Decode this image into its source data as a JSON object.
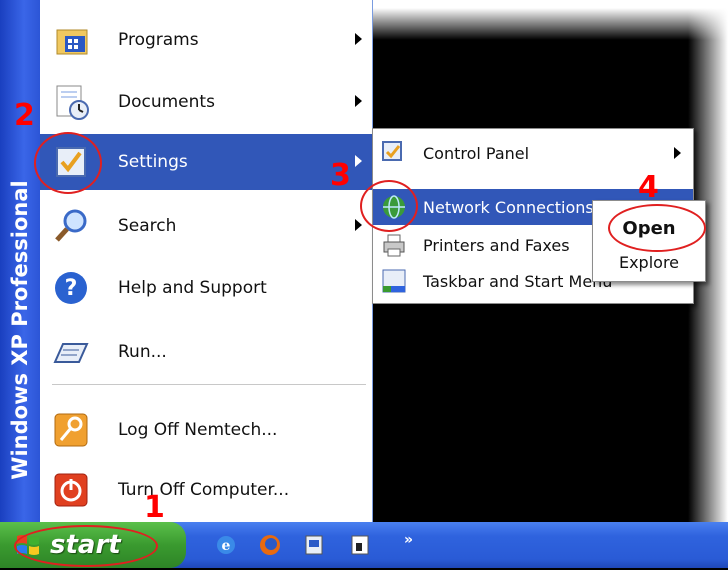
{
  "banner": {
    "text": "Windows XP Professional"
  },
  "start_menu": {
    "items": [
      {
        "label": "Programs",
        "icon": "programs-icon",
        "has_arrow": true
      },
      {
        "label": "Documents",
        "icon": "documents-icon",
        "has_arrow": true
      },
      {
        "label": "Settings",
        "icon": "settings-icon",
        "has_arrow": true
      },
      {
        "label": "Search",
        "icon": "search-icon",
        "has_arrow": true
      },
      {
        "label": "Help and Support",
        "icon": "help-icon",
        "has_arrow": false
      },
      {
        "label": "Run...",
        "icon": "run-icon",
        "has_arrow": false
      },
      {
        "label": "Log Off Nemtech...",
        "icon": "log-off-icon",
        "has_arrow": false
      },
      {
        "label": "Turn Off Computer...",
        "icon": "power-icon",
        "has_arrow": false
      }
    ],
    "highlighted": "Settings"
  },
  "settings_submenu": {
    "items": [
      {
        "label": "Control Panel",
        "icon": "control-panel-icon",
        "has_arrow": true
      },
      {
        "label": "Network Connections",
        "icon": "network-connections-icon",
        "has_arrow": true
      },
      {
        "label": "Printers and Faxes",
        "icon": "printers-icon",
        "has_arrow": false
      },
      {
        "label": "Taskbar and Start Menu",
        "icon": "taskbar-icon",
        "has_arrow": false
      }
    ],
    "highlighted": "Network Connections"
  },
  "context_menu": {
    "items": [
      {
        "label": "Open",
        "bold": true
      },
      {
        "label": "Explore",
        "bold": false
      }
    ]
  },
  "taskbar": {
    "start_label": "start",
    "overflow_label": "»"
  },
  "annotations": {
    "step1": "1",
    "step2": "2",
    "step3": "3",
    "step4": "4"
  },
  "colors": {
    "highlight": "#3157b8",
    "banner": "#3a66e8",
    "start_button": "#3a9a2f",
    "taskbar": "#2f63de",
    "annotation": "#ff0000"
  }
}
